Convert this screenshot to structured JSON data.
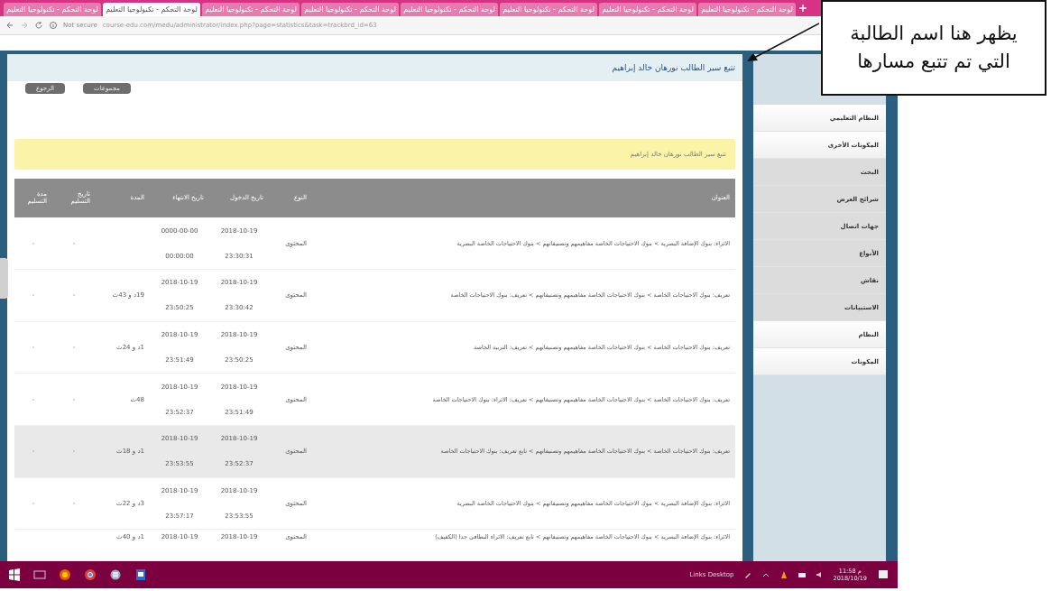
{
  "browser": {
    "tabs": [
      {
        "title": "لوحة التحكم - تكنولوجيا التعليم",
        "selected": false
      },
      {
        "title": "لوحة التحكم - تكنولوجيا التعليم",
        "selected": false
      },
      {
        "title": "لوحة التحكم - تكنولوجيا التعليم",
        "selected": false
      },
      {
        "title": "لوحة التحكم - تكنولوجيا التعليم",
        "selected": false
      },
      {
        "title": "لوحة التحكم - تكنولوجيا التعليم",
        "selected": false
      },
      {
        "title": "لوحة التحكم - تكنولوجيا التعليم",
        "selected": false
      },
      {
        "title": "لوحة التحكم - تكنولوجيا التعليم",
        "selected": true
      },
      {
        "title": "لوحة التحكم - تكنولوجيا التعليم",
        "selected": false
      }
    ],
    "security": "Not secure",
    "url": "course-edu.com/medu/administrator/index.php?page=statistics&task=trackbrd_id=63"
  },
  "page": {
    "title": "تتبع سير الطالب نورهان خالد إبراهيم",
    "buttons": [
      "مجموعات",
      "الرجوع"
    ],
    "notice": "تتبع سير الطالب نورهان خالد إبراهيم",
    "table": {
      "columns": [
        "العنوان",
        "النوع",
        "تاريخ الدخول",
        "تاريخ الانتهاء",
        "المدة",
        "تاريخ التسليم",
        "مدة التسليم"
      ],
      "rows": [
        {
          "title": "الاثراء: بنوك الإضافة البصرية > بنوك الاحتياجات الخاصة مفاهيمهم وتصنيفاتهم > بنوك الاحتياجات الخاصة البصرية",
          "type": "المحتوى",
          "entry_date": "2018-10-19",
          "entry_time": "23:30:31",
          "exit_date": "0000-00-00",
          "exit_time": "00:00:00",
          "submit_date": "-",
          "submit_duration": "-",
          "selected": false
        },
        {
          "title": "تعريف: بنوك الاحتياجات الخاصة > بنوك الاحتياجات الخاصة مفاهيمهم وتصنيفاتهم > تعريف: بنوك الاحتياجات الخاصة",
          "type": "المحتوى",
          "entry_date": "2018-10-19",
          "entry_time": "23:30:42",
          "exit_date": "2018-10-19",
          "exit_time": "23:50:25",
          "duration": "19د و 43ث",
          "submit_date": "-",
          "submit_duration": "-",
          "selected": false
        },
        {
          "title": "تعريف: بنوك الاحتياجات الخاصة > بنوك الاحتياجات الخاصة مفاهيمهم وتصنيفاتهم > تعريف: التربية الخاصة",
          "type": "المحتوى",
          "entry_date": "2018-10-19",
          "entry_time": "23:50:25",
          "exit_date": "2018-10-19",
          "exit_time": "23:51:49",
          "duration": "1د و 24ث",
          "submit_date": "-",
          "submit_duration": "-",
          "selected": false
        },
        {
          "title": "تعريف: بنوك الاحتياجات الخاصة > بنوك الاحتياجات الخاصة مفاهيمهم وتصنيفاتهم > تعريف: الاثراء: بنوك الاحتياجات الخاصة",
          "type": "المحتوى",
          "entry_date": "2018-10-19",
          "entry_time": "23:51:49",
          "exit_date": "2018-10-19",
          "exit_time": "23:52:37",
          "duration": "48ث",
          "submit_date": "-",
          "submit_duration": "-",
          "selected": false
        },
        {
          "title": "تعريف: بنوك الاحتياجات الخاصة > بنوك الاحتياجات الخاصة مفاهيمهم وتصنيفاتهم > تابع تعريف: بنوك الاحتياجات الخاصة",
          "type": "المحتوى",
          "entry_date": "2018-10-19",
          "entry_time": "23:52:37",
          "exit_date": "2018-10-19",
          "exit_time": "23:53:55",
          "duration": "1د و 18ث",
          "submit_date": "-",
          "submit_duration": "-",
          "selected": true
        },
        {
          "title": "الاثراء: بنوك الإضافة البصرية > بنوك الاحتياجات الخاصة مفاهيمهم وتصنيفاتهم > بنوك الاحتياجات الخاصة البصرية",
          "type": "المحتوى",
          "entry_date": "2018-10-19",
          "entry_time": "23:53:55",
          "exit_date": "2018-10-19",
          "exit_time": "23:57:17",
          "duration": "3د و 22ث",
          "submit_date": "-",
          "submit_duration": "-",
          "selected": false
        },
        {
          "title": "الاثراء: بنوك الإضافة البصرية > بنوك الاحتياجات الخاصة مفاهيمهم وتصنيفاتهم > تابع تعريف: الاثراء البطاقي جدا (الكفيف)",
          "type": "المحتوى",
          "entry_date": "2018-10-19",
          "exit_date": "2018-10-19",
          "duration": "1د و 40ث",
          "selected": false
        }
      ]
    }
  },
  "sidebar": {
    "items": [
      {
        "label": "النظام التعليمي",
        "shaded": false
      },
      {
        "label": "المكونات الأخرى",
        "shaded": false
      },
      {
        "label": "البحث",
        "shaded": true
      },
      {
        "label": "شرائح العرض",
        "shaded": true
      },
      {
        "label": "جهات اتصال",
        "shaded": true
      },
      {
        "label": "الأنواع",
        "shaded": true
      },
      {
        "label": "نقاش",
        "shaded": true
      },
      {
        "label": "الاستبيانات",
        "shaded": true
      },
      {
        "label": "النظام",
        "shaded": false
      },
      {
        "label": "المكونات",
        "shaded": false
      }
    ]
  },
  "taskbar": {
    "tray_label": "Links Desktop",
    "time": "م 11:58",
    "date": "2018/10/19"
  },
  "callout": {
    "lines": [
      "يظهر هنا اسم الطالبة",
      "التي تم تتبع مسارها"
    ]
  }
}
